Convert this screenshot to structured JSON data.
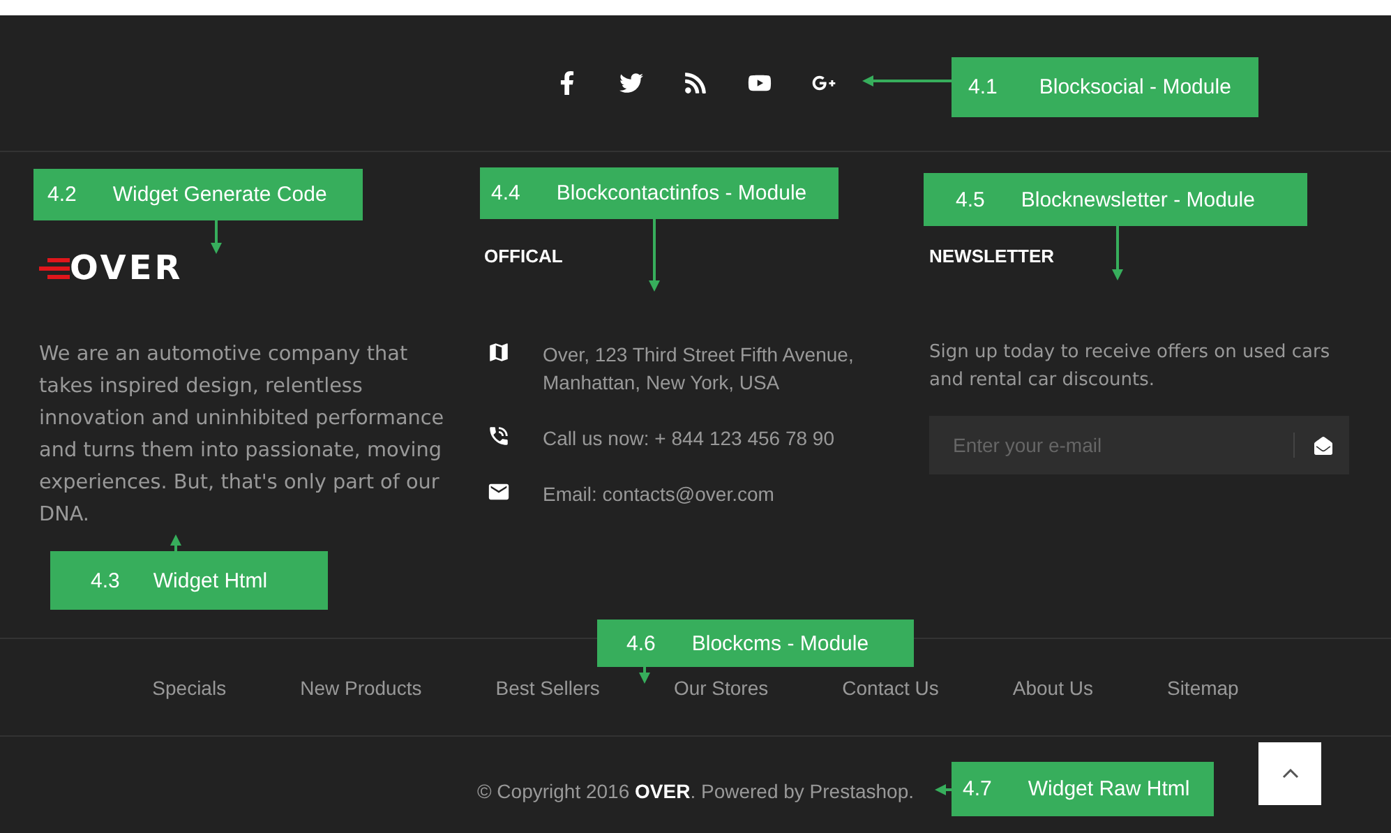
{
  "social_links": [
    {
      "kind": "facebook"
    },
    {
      "kind": "twitter"
    },
    {
      "kind": "rss"
    },
    {
      "kind": "youtube"
    },
    {
      "kind": "google-plus"
    }
  ],
  "about": {
    "logo": "OVER",
    "text": "We are an automotive company that takes inspired design, relentless innovation and uninhibited performance and turns them into passionate, moving experiences. But, that's only part of our DNA."
  },
  "contact": {
    "heading": "OFFICAL",
    "items": [
      {
        "kind": "address",
        "text": "Over, 123 Third Street Fifth Avenue, Manhattan, New York, USA"
      },
      {
        "kind": "phone",
        "text": "Call us now: + 844 123 456 78 90"
      },
      {
        "kind": "email",
        "text": "Email: contacts@over.com"
      }
    ]
  },
  "newsletter": {
    "heading": "NEWSLETTER",
    "text": "Sign up today to receive offers on used cars and rental car discounts.",
    "placeholder": "Enter your e-mail"
  },
  "footer_links": [
    "Specials",
    "New Products",
    "Best Sellers",
    "Our Stores",
    "Contact Us",
    "About Us",
    "Sitemap"
  ],
  "copyright": "© Copyright 2016 **OVER**. Powered by Prestashop.",
  "annotations": [
    {
      "number": "4.1",
      "label": "Blocksocial - Module"
    },
    {
      "number": "4.2",
      "label": "Widget Generate Code"
    },
    {
      "number": "4.3",
      "label": "Widget Html"
    },
    {
      "number": "4.4",
      "label": "Blockcontactinfos - Module"
    },
    {
      "number": "4.5",
      "label": "Blocknewsletter - Module"
    },
    {
      "number": "4.6",
      "label": "Blockcms - Module"
    },
    {
      "number": "4.7",
      "label": "Widget Raw Html"
    }
  ]
}
